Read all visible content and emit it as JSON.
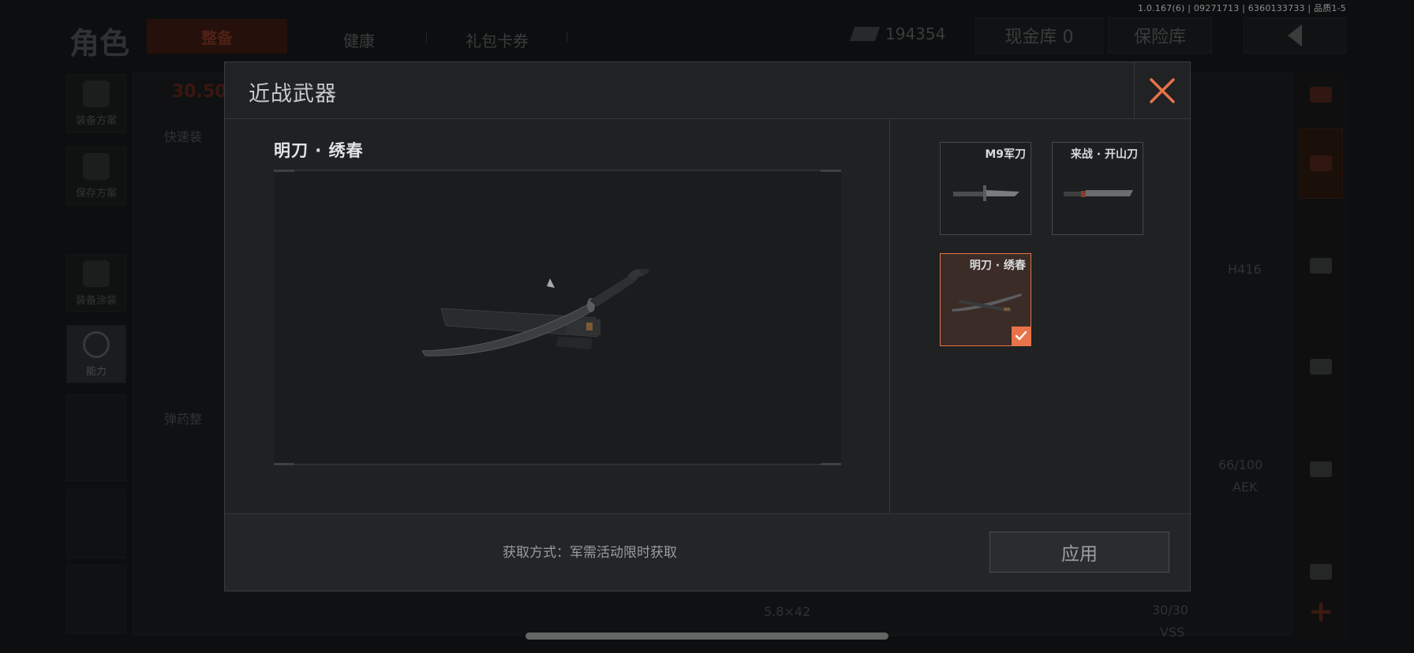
{
  "version_text": "1.0.167(6) | 09271713 | 6360133733 | 品质1-5",
  "background": {
    "title": "角色",
    "tabs": [
      "整备",
      "健康",
      "礼包卡券"
    ],
    "currency_value": "194354",
    "cash_vault_label": "现金库 0",
    "insurance_label": "保险库",
    "sidebar": [
      "装备方案",
      "保存方案",
      "装备涂装",
      "能力"
    ],
    "health_value": "30.50",
    "quick_equip_label": "快速装",
    "ammo_label": "弹药整",
    "weapon_labels": [
      "H416",
      "66/100",
      "AEK",
      "5.8×42",
      "30/30",
      "VSS"
    ]
  },
  "modal": {
    "title": "近战武器",
    "selected_item_name": "明刀 · 绣春",
    "items": [
      {
        "label": "M9军刀",
        "selected": false,
        "icon": "bayonet-icon"
      },
      {
        "label": "来战 · 开山刀",
        "selected": false,
        "icon": "machete-icon"
      },
      {
        "label": "明刀 · 绣春",
        "selected": true,
        "icon": "katana-icon"
      }
    ],
    "obtain_text": "获取方式：军需活动限时获取",
    "apply_label": "应用"
  },
  "colors": {
    "accent": "#e8734a",
    "modal_bg": "#1f2122",
    "selected_card_bg": "#3b2c27"
  }
}
